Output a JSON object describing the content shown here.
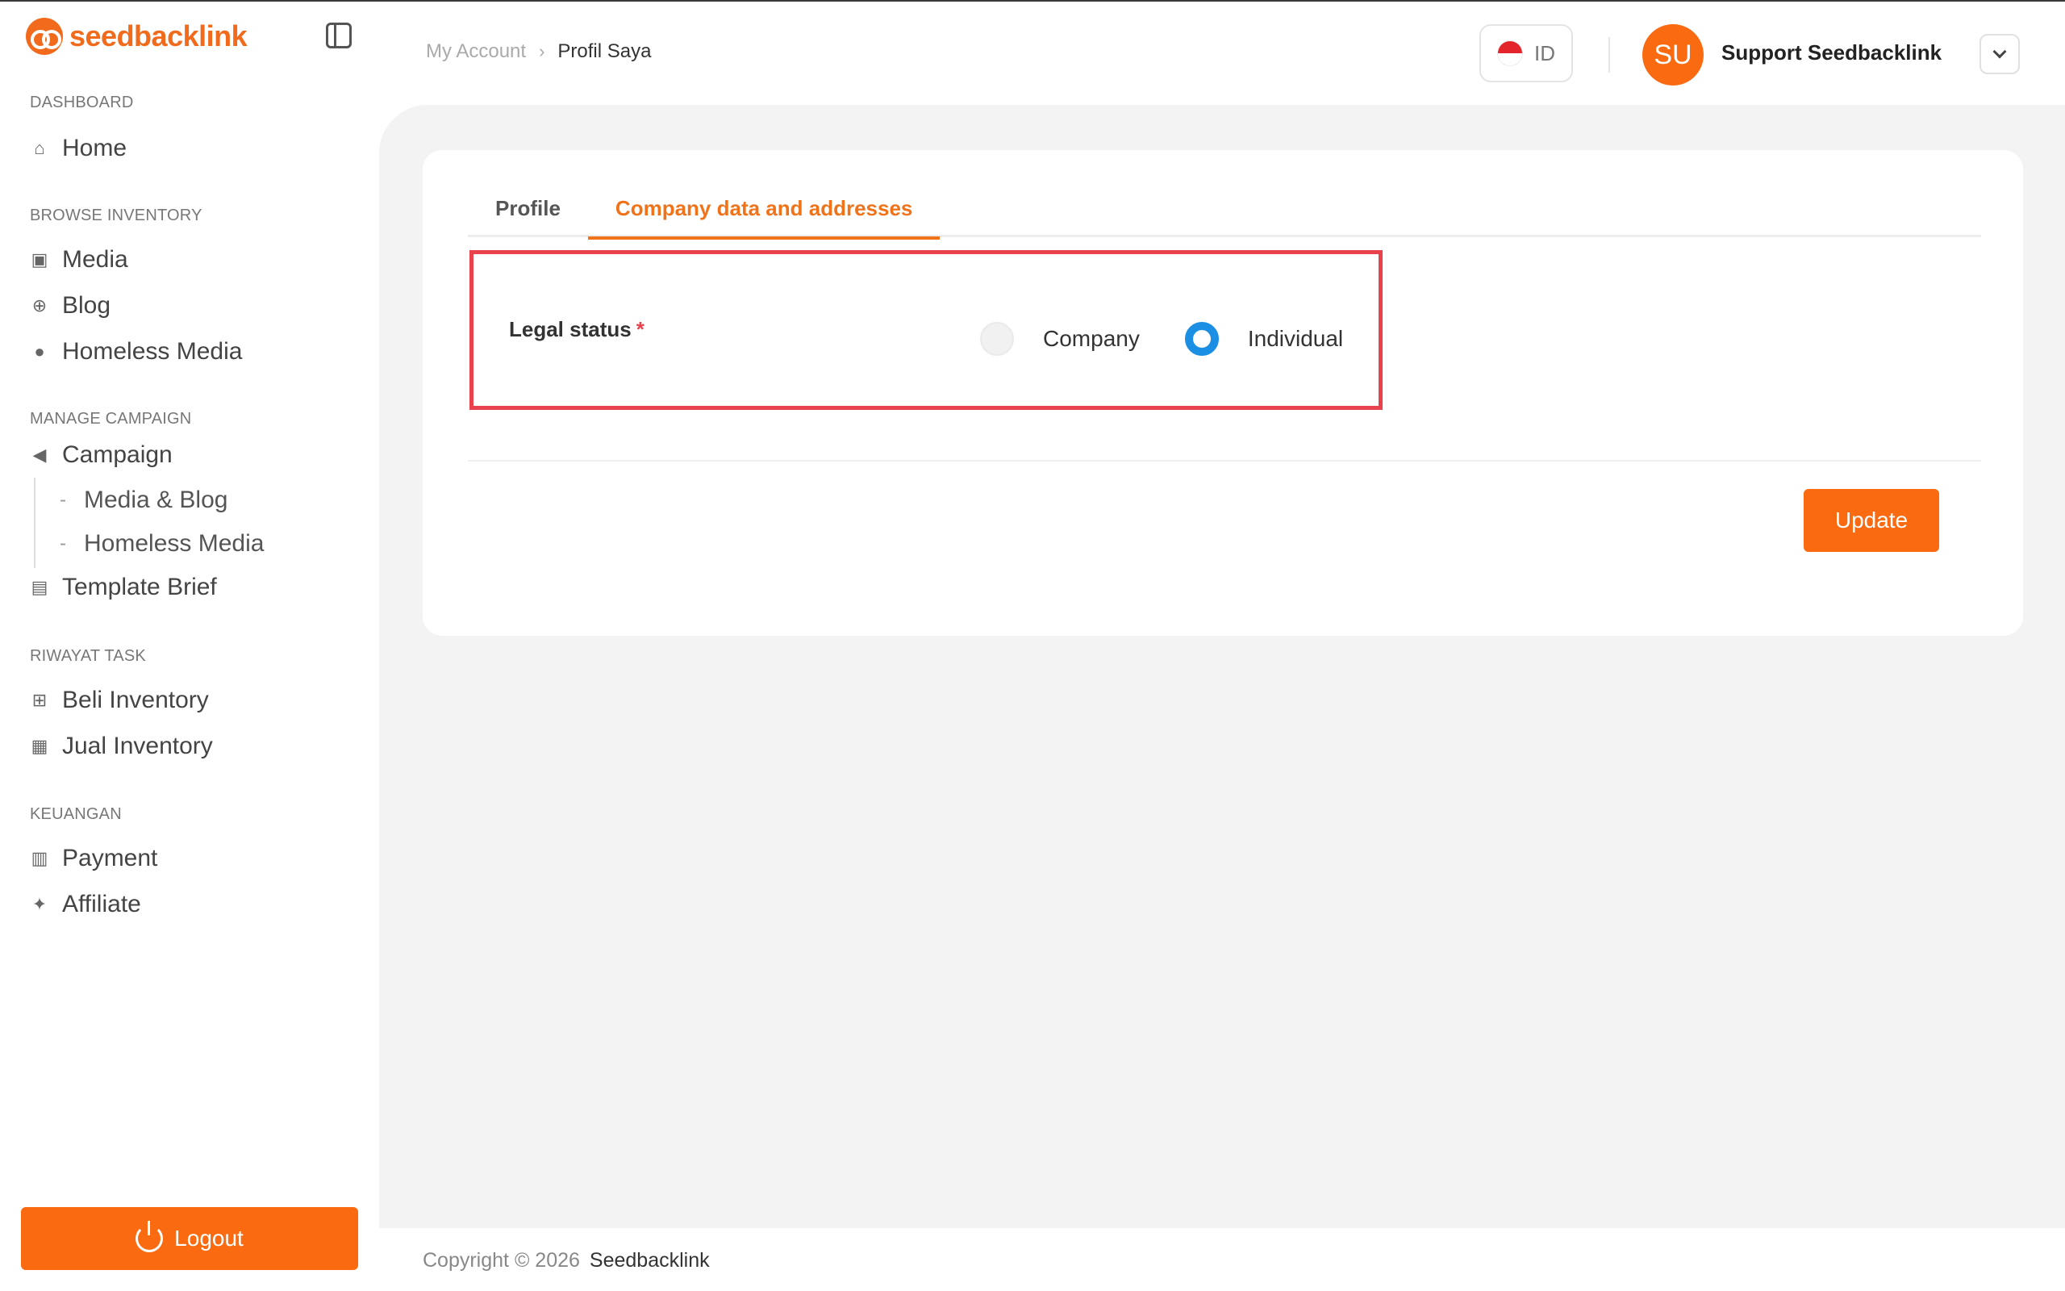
{
  "brand": {
    "logo_text": "seedbacklink",
    "accent": "#fa6a10"
  },
  "sidebar": {
    "sections": [
      {
        "title": "DASHBOARD"
      },
      {
        "title": "BROWSE INVENTORY"
      },
      {
        "title": "MANAGE CAMPAIGN"
      },
      {
        "title": "RIWAYAT TASK"
      },
      {
        "title": "KEUANGAN"
      }
    ],
    "items": {
      "home": "Home",
      "media": "Media",
      "blog": "Blog",
      "homeless_media": "Homeless Media",
      "campaign": "Campaign",
      "campaign_media_blog": "Media & Blog",
      "campaign_homeless_media": "Homeless Media",
      "template_brief": "Template Brief",
      "beli_inventory": "Beli Inventory",
      "jual_inventory": "Jual Inventory",
      "payment": "Payment",
      "affiliate": "Affiliate"
    },
    "logout_label": "Logout"
  },
  "header": {
    "breadcrumb": {
      "parent": "My Account",
      "current": "Profil Saya"
    },
    "language": "ID",
    "user": {
      "initials": "SU",
      "name": "Support Seedbacklink"
    }
  },
  "main": {
    "tabs": [
      {
        "label": "Profile",
        "active": false
      },
      {
        "label": "Company data and addresses",
        "active": true
      }
    ],
    "legal_status": {
      "label": "Legal status",
      "required_mark": "*",
      "options": [
        "Company",
        "Individual"
      ],
      "selected": "Individual"
    },
    "update_label": "Update"
  },
  "footer": {
    "copyright": "Copyright © 2026",
    "brand": "Seedbacklink"
  }
}
